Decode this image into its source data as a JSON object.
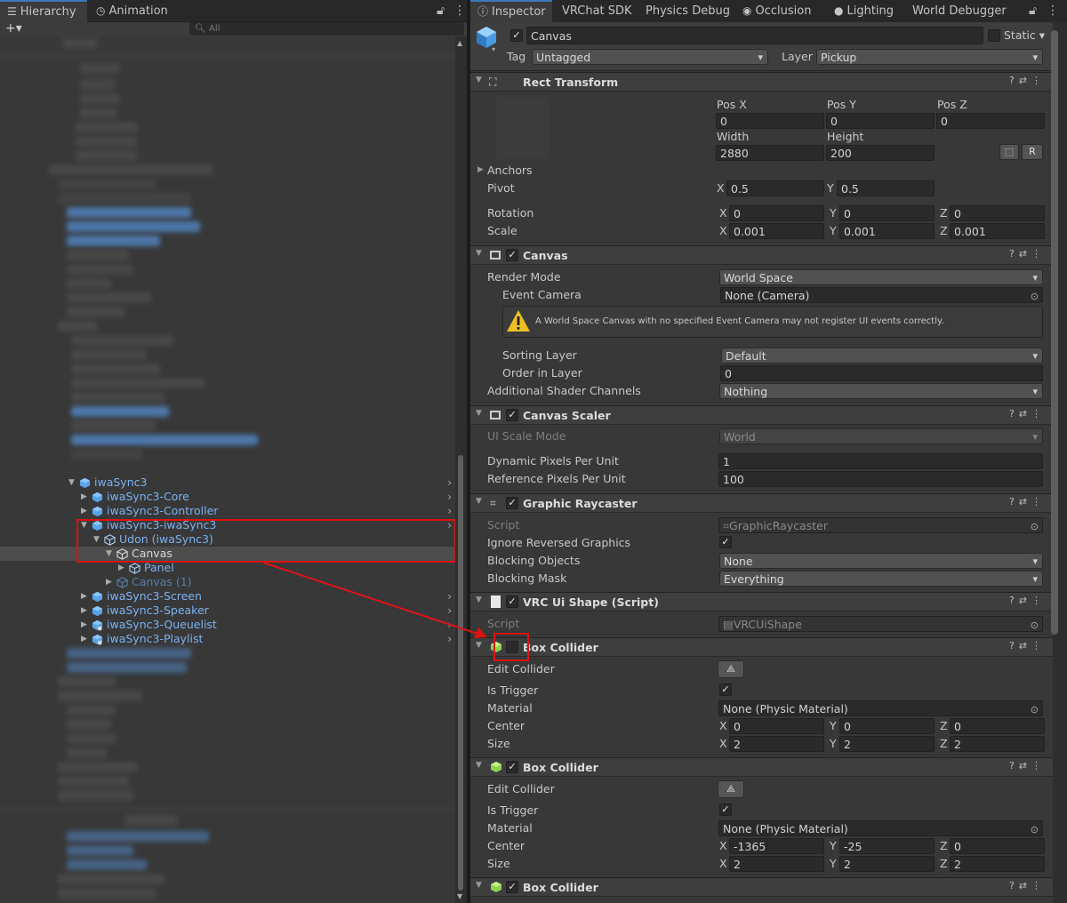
{
  "hierarchy": {
    "tabs": [
      {
        "label": "Hierarchy",
        "icon": "list-icon"
      },
      {
        "label": "Animation",
        "icon": "clock-icon"
      }
    ],
    "add_button": "+▾",
    "search_placeholder": "All",
    "rows": [
      {
        "label": "iwaSync3",
        "style": "prefab",
        "expanded": true
      },
      {
        "label": "iwaSync3-Core",
        "style": "prefab"
      },
      {
        "label": "iwaSync3-Controller",
        "style": "prefab"
      },
      {
        "label": "iwaSync3-iwaSync3",
        "style": "prefab",
        "expanded": true
      },
      {
        "label": "Udon (iwaSync3)",
        "style": "prefab",
        "expanded": true
      },
      {
        "label": "Canvas",
        "style": "plain",
        "selected": true,
        "expanded": true
      },
      {
        "label": "Panel",
        "style": "prefab"
      },
      {
        "label": "Canvas (1)",
        "style": "prefab-dim"
      },
      {
        "label": "iwaSync3-Screen",
        "style": "prefab"
      },
      {
        "label": "iwaSync3-Speaker",
        "style": "prefab"
      },
      {
        "label": "iwaSync3-Queuelist",
        "style": "prefab"
      },
      {
        "label": "iwaSync3-Playlist",
        "style": "prefab"
      }
    ]
  },
  "inspector": {
    "tabs": [
      {
        "label": "Inspector",
        "icon": "info-icon"
      },
      {
        "label": "VRChat SDK"
      },
      {
        "label": "Physics Debug"
      },
      {
        "label": "Occlusion",
        "icon": "eye-icon"
      },
      {
        "label": "Lighting",
        "icon": "bulb-icon"
      },
      {
        "label": "World Debugger"
      }
    ],
    "object_name": "Canvas",
    "static_label": "Static",
    "tag_label": "Tag",
    "tag_value": "Untagged",
    "layer_label": "Layer",
    "layer_value": "Pickup",
    "rect_transform": {
      "title": "Rect Transform",
      "posx_label": "Pos X",
      "posy_label": "Pos Y",
      "posz_label": "Pos Z",
      "posx": "0",
      "posy": "0",
      "posz": "0",
      "width_label": "Width",
      "height_label": "Height",
      "width": "2880",
      "height": "200",
      "r_button": "R",
      "anchors_label": "Anchors",
      "pivot_label": "Pivot",
      "pivot_x": "0.5",
      "pivot_y": "0.5",
      "rotation_label": "Rotation",
      "rot_x": "0",
      "rot_y": "0",
      "rot_z": "0",
      "scale_label": "Scale",
      "scale_x": "0.001",
      "scale_y": "0.001",
      "scale_z": "0.001"
    },
    "canvas": {
      "title": "Canvas",
      "render_mode_label": "Render Mode",
      "render_mode": "World Space",
      "event_camera_label": "Event Camera",
      "event_camera": "None (Camera)",
      "warning": "A World Space Canvas with no specified Event Camera may not register UI events correctly.",
      "sorting_layer_label": "Sorting Layer",
      "sorting_layer": "Default",
      "order_label": "Order in Layer",
      "order": "0",
      "shader_label": "Additional Shader Channels",
      "shader": "Nothing"
    },
    "canvas_scaler": {
      "title": "Canvas Scaler",
      "ui_scale_label": "UI Scale Mode",
      "ui_scale": "World",
      "dpu_label": "Dynamic Pixels Per Unit",
      "dpu": "1",
      "rppu_label": "Reference Pixels Per Unit",
      "rppu": "100"
    },
    "graphic_raycaster": {
      "title": "Graphic Raycaster",
      "script_label": "Script",
      "script": "GraphicRaycaster",
      "ignore_label": "Ignore Reversed Graphics",
      "blocking_label": "Blocking Objects",
      "blocking": "None",
      "mask_label": "Blocking Mask",
      "mask": "Everything"
    },
    "vrc_ui_shape": {
      "title": "VRC Ui Shape (Script)",
      "script_label": "Script",
      "script": "VRCUiShape"
    },
    "box_collider_1": {
      "title": "Box Collider",
      "edit_label": "Edit Collider",
      "trigger_label": "Is Trigger",
      "material_label": "Material",
      "material": "None (Physic Material)",
      "center_label": "Center",
      "cx": "0",
      "cy": "0",
      "cz": "0",
      "size_label": "Size",
      "sx": "2",
      "sy": "2",
      "sz": "2"
    },
    "box_collider_2": {
      "title": "Box Collider",
      "edit_label": "Edit Collider",
      "trigger_label": "Is Trigger",
      "material_label": "Material",
      "material": "None (Physic Material)",
      "center_label": "Center",
      "cx": "-1365",
      "cy": "-25",
      "cz": "0",
      "size_label": "Size",
      "sx": "2",
      "sy": "2",
      "sz": "2"
    },
    "box_collider_3": {
      "title": "Box Collider"
    },
    "axis": {
      "x": "X",
      "y": "Y",
      "z": "Z"
    }
  },
  "colors": {
    "highlight": "#e01212",
    "prefab_text": "#7cb1f0",
    "accent_tab": "#3a79bb"
  }
}
